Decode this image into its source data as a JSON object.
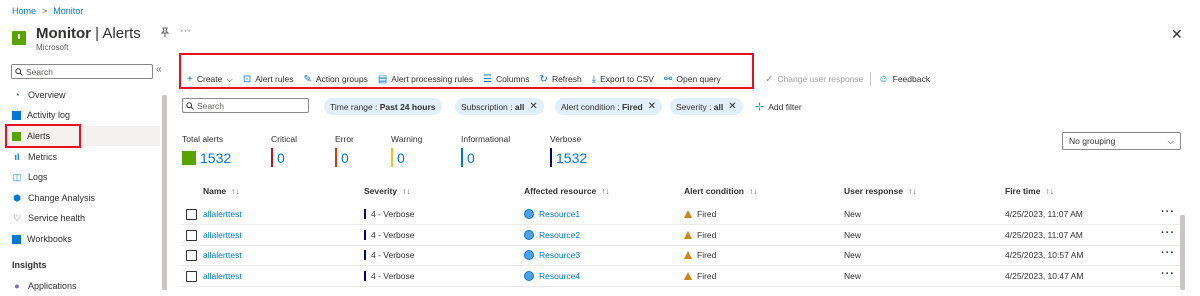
{
  "breadcrumb": {
    "home": "Home",
    "current": "Monitor",
    "separator": ">"
  },
  "header": {
    "title_bold": "Monitor",
    "title_sep": " | ",
    "title_rest": "Alerts",
    "subtitle": "Microsoft",
    "more": "···",
    "close": "✕"
  },
  "sidebar": {
    "search_placeholder": "Search",
    "collapse": "«",
    "items": [
      {
        "label": "Overview",
        "icon": "overview-icon"
      },
      {
        "label": "Activity log",
        "icon": "activity-log-icon"
      },
      {
        "label": "Alerts",
        "icon": "alerts-icon"
      },
      {
        "label": "Metrics",
        "icon": "metrics-icon"
      },
      {
        "label": "Logs",
        "icon": "logs-icon"
      },
      {
        "label": "Change Analysis",
        "icon": "change-analysis-icon"
      },
      {
        "label": "Service health",
        "icon": "heart-icon"
      },
      {
        "label": "Workbooks",
        "icon": "workbooks-icon"
      }
    ],
    "section": "Insights",
    "section_item": "Applications"
  },
  "toolbar": {
    "create": "Create",
    "alert_rules": "Alert rules",
    "action_groups": "Action groups",
    "processing_rules": "Alert processing rules",
    "columns": "Columns",
    "refresh": "Refresh",
    "export": "Export to CSV",
    "open_query": "Open query",
    "change_response": "Change user response",
    "feedback": "Feedback"
  },
  "filters": {
    "search_placeholder": "Search",
    "time_range_label": "Time range : ",
    "time_range_value": "Past 24 hours",
    "subscription_label": "Subscription : ",
    "subscription_value": "all",
    "condition_label": "Alert condition : ",
    "condition_value": "Fired",
    "severity_label": "Severity : ",
    "severity_value": "all",
    "add_filter": "Add filter"
  },
  "summary": {
    "total_label": "Total alerts",
    "total": "1532",
    "critical_label": "Critical",
    "critical": "0",
    "error_label": "Error",
    "error": "0",
    "warning_label": "Warning",
    "warning": "0",
    "informational_label": "Informational",
    "informational": "0",
    "verbose_label": "Verbose",
    "verbose": "1532",
    "colors": {
      "critical": "#c50f1f",
      "error": "#da3b01",
      "warning": "#f0c419",
      "informational": "#0078d4",
      "verbose": "#000080"
    }
  },
  "grouping": {
    "value": "No grouping"
  },
  "table": {
    "columns": [
      "Name",
      "Severity",
      "Affected resource",
      "Alert condition",
      "User response",
      "Fire time"
    ],
    "sort_icon": "↑↓",
    "rows": [
      {
        "name": "allalerttest",
        "severity": "4 - Verbose",
        "resource": "Resource1",
        "condition": "Fired",
        "response": "New",
        "time": "4/25/2023, 11:07 AM"
      },
      {
        "name": "allalerttest",
        "severity": "4 - Verbose",
        "resource": "Resource2",
        "condition": "Fired",
        "response": "New",
        "time": "4/25/2023, 11:07 AM"
      },
      {
        "name": "allalerttest",
        "severity": "4 - Verbose",
        "resource": "Resource3",
        "condition": "Fired",
        "response": "New",
        "time": "4/25/2023, 10:57 AM"
      },
      {
        "name": "allalerttest",
        "severity": "4 - Verbose",
        "resource": "Resource4",
        "condition": "Fired",
        "response": "New",
        "time": "4/25/2023, 10:47 AM"
      }
    ],
    "row_more": "···"
  }
}
